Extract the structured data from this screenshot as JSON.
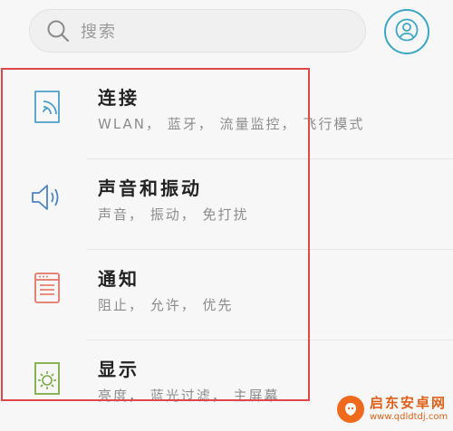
{
  "search": {
    "placeholder": "搜索",
    "icon": "search-icon"
  },
  "account": {
    "icon": "user-icon",
    "color": "#3aa7c6"
  },
  "highlight_color": "#e04848",
  "settings": [
    {
      "title": "连接",
      "subtitle": "WLAN， 蓝牙， 流量监控， 飞行模式",
      "icon": "connection-icon",
      "icon_color": "#4a9fc9"
    },
    {
      "title": "声音和振动",
      "subtitle": "声音， 振动， 免打扰",
      "icon": "speaker-icon",
      "icon_color": "#4a84c9"
    },
    {
      "title": "通知",
      "subtitle": "阻止， 允许， 优先",
      "icon": "notification-icon",
      "icon_color": "#e57466"
    },
    {
      "title": "显示",
      "subtitle": "亮度， 蓝光过滤， 主屏幕",
      "icon": "display-icon",
      "icon_color": "#7cab3f"
    }
  ],
  "watermark": {
    "title": "启东安卓网",
    "url": "www.qdldtdj.com",
    "color": "#e0601a"
  }
}
